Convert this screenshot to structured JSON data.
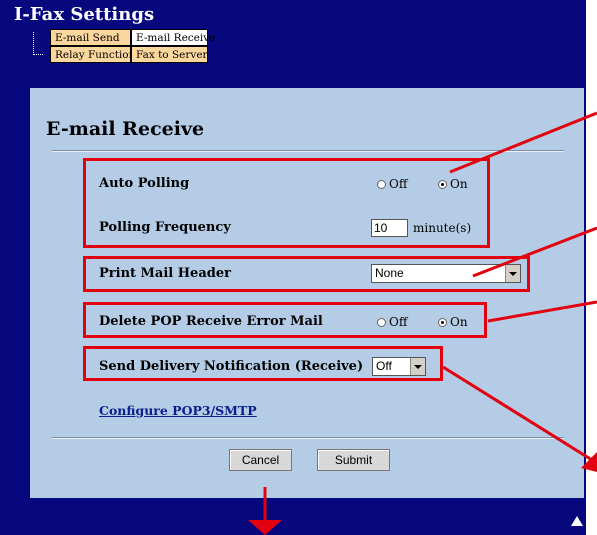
{
  "header": {
    "title": "I-Fax Settings"
  },
  "tabs": [
    {
      "label": "E-mail Send",
      "active": false
    },
    {
      "label": "E-mail Receive",
      "active": true
    },
    {
      "label": "Relay Function",
      "active": false
    },
    {
      "label": "Fax to Server",
      "active": false
    }
  ],
  "page": {
    "title": "E-mail Receive"
  },
  "settings": {
    "auto_polling": {
      "label": "Auto Polling",
      "off_label": "Off",
      "on_label": "On",
      "selected": "On"
    },
    "polling_frequency": {
      "label": "Polling Frequency",
      "value": "10",
      "unit": "minute(s)"
    },
    "print_mail_header": {
      "label": "Print Mail Header",
      "selected": "None"
    },
    "delete_pop_error": {
      "label": "Delete POP Receive Error Mail",
      "off_label": "Off",
      "on_label": "On",
      "selected": "On"
    },
    "send_delivery_notification": {
      "label": "Send Delivery Notification (Receive)",
      "selected": "Off"
    }
  },
  "links": {
    "configure": "Configure POP3/SMTP"
  },
  "buttons": {
    "cancel": "Cancel",
    "submit": "Submit"
  },
  "colors": {
    "background": "#07077e",
    "panel": "#b4cce6",
    "tab": "#fbd79d",
    "highlight": "#e3000f"
  }
}
